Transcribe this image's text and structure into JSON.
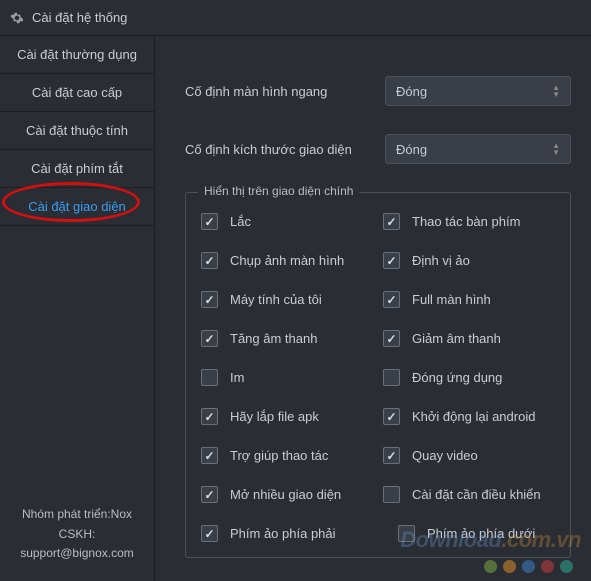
{
  "title": "Cài đặt hệ thống",
  "sidebar": {
    "items": [
      {
        "label": "Cài đặt thường dụng"
      },
      {
        "label": "Cài đặt cao cấp"
      },
      {
        "label": "Cài đặt thuộc tính"
      },
      {
        "label": "Cài đặt phím tắt"
      },
      {
        "label": "Cài đặt giao diện"
      }
    ],
    "footer_line1": "Nhóm phát triển:Nox",
    "footer_line2": "CSKH:",
    "footer_line3": "support@bignox.com"
  },
  "main": {
    "row1": {
      "label": "Cố định màn hình ngang",
      "value": "Đóng"
    },
    "row2": {
      "label": "Cố định kích thước giao diện",
      "value": "Đóng"
    },
    "fieldset_title": "Hiển thị trên giao diện chính",
    "checkboxes": [
      {
        "label": "Lắc",
        "checked": true
      },
      {
        "label": "Thao tác bàn phím",
        "checked": true
      },
      {
        "label": "Chụp ảnh màn hình",
        "checked": true
      },
      {
        "label": "Định vị ảo",
        "checked": true
      },
      {
        "label": "Máy tính của tôi",
        "checked": true
      },
      {
        "label": "Full màn hình",
        "checked": true
      },
      {
        "label": "Tăng âm thanh",
        "checked": true
      },
      {
        "label": "Giảm âm thanh",
        "checked": true
      },
      {
        "label": "Im",
        "checked": false
      },
      {
        "label": "Đóng ứng dụng",
        "checked": false
      },
      {
        "label": "Hãy lắp file apk",
        "checked": true
      },
      {
        "label": "Khởi động lại android",
        "checked": true
      },
      {
        "label": "Trợ giúp thao tác",
        "checked": true
      },
      {
        "label": "Quay video",
        "checked": true
      },
      {
        "label": "Mở nhiều giao diện",
        "checked": true
      },
      {
        "label": "Cài đặt cần điều khiển",
        "checked": false
      }
    ],
    "footer_checks": [
      {
        "label": "Phím ảo phía phải",
        "checked": true
      },
      {
        "label": "Phím ảo phía dưới",
        "checked": false
      }
    ]
  },
  "watermark": {
    "t1": "Download",
    "t2": ".com.vn"
  },
  "dot_colors": [
    "#7aa844",
    "#d88c2a",
    "#3a80c8",
    "#c83a3a",
    "#2aa88c"
  ]
}
